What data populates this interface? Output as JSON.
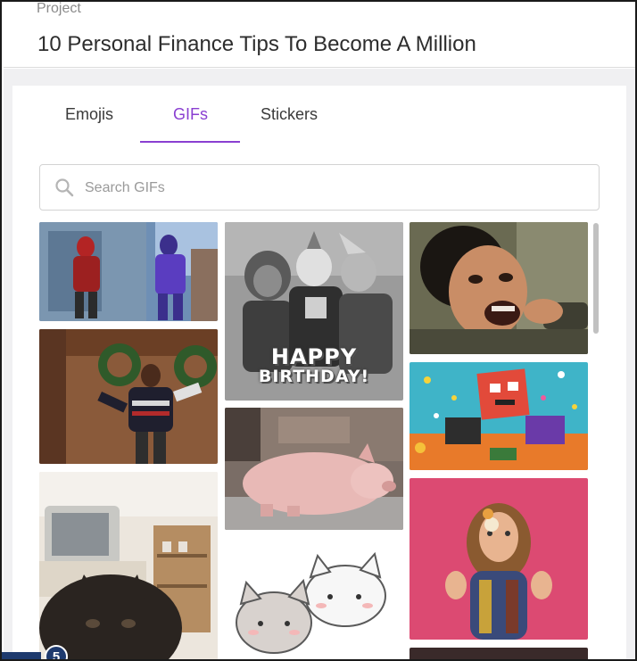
{
  "project": {
    "label": "Project",
    "title": "10 Personal Finance Tips To Become A Millionaire"
  },
  "tabs": [
    {
      "label": "Emojis",
      "active": false
    },
    {
      "label": "GIFs",
      "active": true
    },
    {
      "label": "Stickers",
      "active": false
    }
  ],
  "search": {
    "placeholder": "Search GIFs",
    "value": ""
  },
  "gifs": [
    {
      "icon": "superheroes-gif"
    },
    {
      "icon": "dancing-man-sweater-gif"
    },
    {
      "icon": "kitten-tv-gif"
    },
    {
      "icon": "happy-birthday-gif",
      "caption_line1": "HAPPY",
      "caption_line2": "BIRTHDAY!"
    },
    {
      "icon": "sleeping-pig-gif"
    },
    {
      "icon": "cute-cats-gif"
    },
    {
      "icon": "excited-man-gif"
    },
    {
      "icon": "confetti-robot-gif"
    },
    {
      "icon": "woman-blowing-kiss-gif"
    }
  ],
  "page_badge": "5",
  "colors": {
    "accent": "#8a3fd1",
    "badge": "#1e3a6e"
  }
}
